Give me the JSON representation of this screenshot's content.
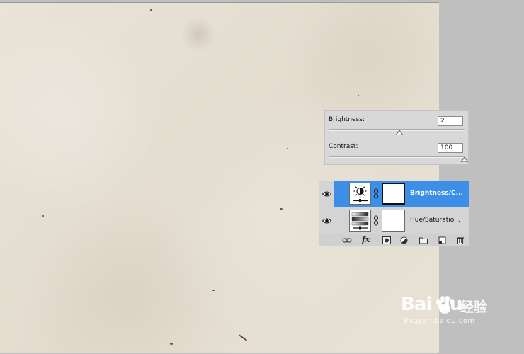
{
  "adjustments": {
    "brightness": {
      "label": "Brightness:",
      "value": "2",
      "level": 0.52
    },
    "contrast": {
      "label": "Contrast:",
      "value": "100",
      "level": 1.0
    }
  },
  "layers": [
    {
      "name": "Brightness/C...",
      "thumbnail_icon": "brightness-contrast-icon",
      "selected": true,
      "visible": true
    },
    {
      "name": "Hue/Saturatio...",
      "thumbnail_icon": "hue-saturation-icon",
      "selected": false,
      "visible": true
    }
  ],
  "layer_toolbar": [
    "link-layers-icon",
    "fx-icon",
    "add-mask-icon",
    "new-adjustment-layer-icon",
    "new-group-icon",
    "new-layer-icon",
    "delete-layer-icon"
  ],
  "layer_toolbar_labels": {
    "fx": "fx"
  },
  "watermark": {
    "brand": "Bai  du",
    "chinese": "经验",
    "url": "jingyan.baidu.com"
  },
  "colors": {
    "selection": "#3d8ee6",
    "canvas": "#e6e0d5",
    "workspace": "#bfbfbf"
  }
}
